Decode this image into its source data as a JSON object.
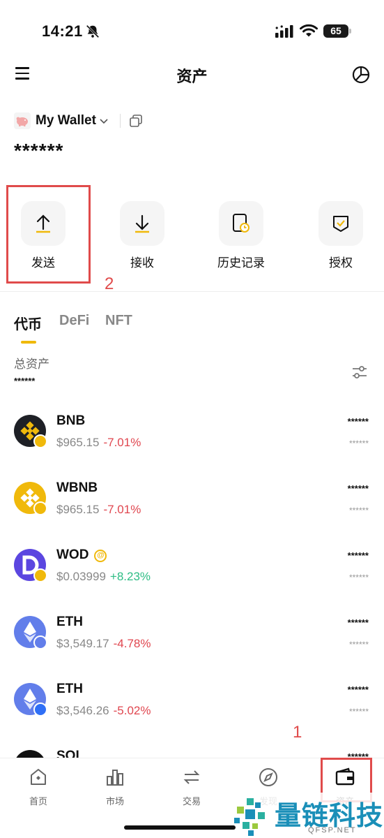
{
  "status": {
    "time": "14:21",
    "battery": "65"
  },
  "header": {
    "title": "资产"
  },
  "wallet": {
    "name": "My Wallet",
    "balance": "******"
  },
  "actions": [
    {
      "label": "发送",
      "icon": "upload-arrow-icon"
    },
    {
      "label": "接收",
      "icon": "download-arrow-icon"
    },
    {
      "label": "历史记录",
      "icon": "history-clock-icon"
    },
    {
      "label": "授权",
      "icon": "shield-check-icon"
    }
  ],
  "annotations": {
    "send_step": "2",
    "assets_step": "1",
    "highlight_color": "#e04b4b"
  },
  "tabs": [
    {
      "label": "代币",
      "active": true
    },
    {
      "label": "DeFi",
      "active": false
    },
    {
      "label": "NFT",
      "active": false
    }
  ],
  "total": {
    "label": "总资产",
    "value": "******"
  },
  "tokens": [
    {
      "symbol": "BNB",
      "price": "$965.15",
      "change": "-7.01%",
      "direction": "down",
      "amount": "******",
      "value": "******",
      "logo_color": "#1e2026",
      "badge_color": "#f0b90b"
    },
    {
      "symbol": "WBNB",
      "price": "$965.15",
      "change": "-7.01%",
      "direction": "down",
      "amount": "******",
      "value": "******",
      "logo_color": "#f0b90b",
      "badge_color": "#f0b90b"
    },
    {
      "symbol": "WOD",
      "price": "$0.03999",
      "change": "+8.23%",
      "direction": "up",
      "amount": "******",
      "value": "******",
      "logo_color": "#5b46e0",
      "badge_color": "#f0b90b",
      "at_badge": "@"
    },
    {
      "symbol": "ETH",
      "price": "$3,549.17",
      "change": "-4.78%",
      "direction": "down",
      "amount": "******",
      "value": "******",
      "logo_color": "#627eea",
      "badge_color": "#627eea"
    },
    {
      "symbol": "ETH",
      "price": "$3,546.26",
      "change": "-5.02%",
      "direction": "down",
      "amount": "******",
      "value": "******",
      "logo_color": "#627eea",
      "badge_color": "#2f6ff6"
    },
    {
      "symbol": "SOL",
      "amount": "******",
      "logo_color": "#111111"
    }
  ],
  "nav": [
    {
      "label": "首页",
      "icon": "home-icon"
    },
    {
      "label": "市场",
      "icon": "market-chart-icon"
    },
    {
      "label": "交易",
      "icon": "swap-icon"
    },
    {
      "label": "发现",
      "icon": "compass-icon"
    },
    {
      "label": "资产",
      "icon": "wallet-icon"
    }
  ],
  "watermark": {
    "text": "量链科技",
    "sub": "QFSP.NET"
  }
}
